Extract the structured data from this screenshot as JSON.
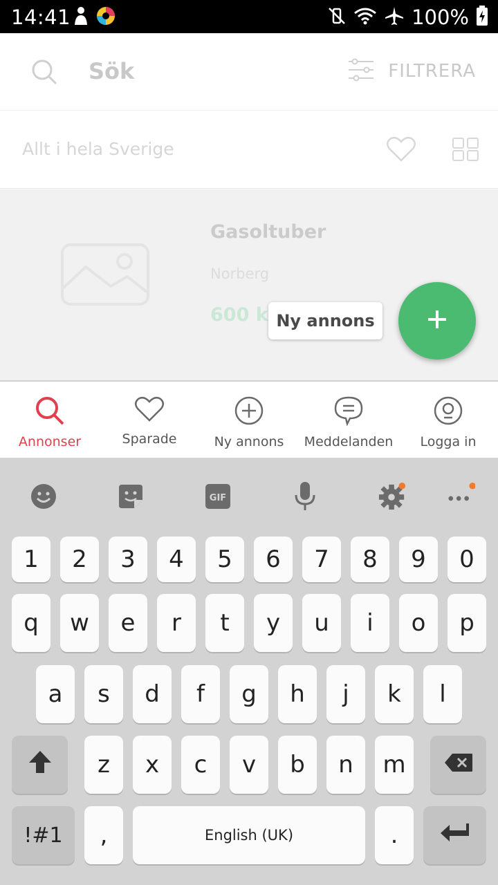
{
  "status_bar": {
    "time": "14:41",
    "battery": "100%"
  },
  "search_header": {
    "title": "Sök",
    "filter_label": "FILTRERA"
  },
  "location_row": {
    "text": "Allt i hela Sverige"
  },
  "listing": {
    "title": "Gasoltuber",
    "location": "Norberg",
    "price": "600 kr"
  },
  "tooltip": {
    "text": "Ny annons"
  },
  "colors": {
    "accent_red": "#e0404e",
    "fab_green": "#4cbb72",
    "price_green": "#c9e8d5"
  },
  "bottom_nav": {
    "items": [
      {
        "label": "Annonser",
        "icon": "search-icon",
        "active": true
      },
      {
        "label": "Sparade",
        "icon": "heart-icon",
        "active": false
      },
      {
        "label": "Ny annons",
        "icon": "plus-circle-icon",
        "active": false
      },
      {
        "label": "Meddelanden",
        "icon": "chat-bubble-icon",
        "active": false
      },
      {
        "label": "Logga in",
        "icon": "user-circle-icon",
        "active": false
      }
    ]
  },
  "keyboard": {
    "toolbar": [
      "emoji-icon",
      "sticker-icon",
      "gif-icon",
      "microphone-icon",
      "settings-icon",
      "more-icon"
    ],
    "gif_label": "GIF",
    "row_numbers": [
      "1",
      "2",
      "3",
      "4",
      "5",
      "6",
      "7",
      "8",
      "9",
      "0"
    ],
    "row_q": [
      "q",
      "w",
      "e",
      "r",
      "t",
      "y",
      "u",
      "i",
      "o",
      "p"
    ],
    "row_a": [
      "a",
      "s",
      "d",
      "f",
      "g",
      "h",
      "j",
      "k",
      "l"
    ],
    "row_z": [
      "z",
      "x",
      "c",
      "v",
      "b",
      "n",
      "m"
    ],
    "symbols_label": "!#1",
    "comma": ",",
    "space_label": "English (UK)",
    "period": "."
  }
}
